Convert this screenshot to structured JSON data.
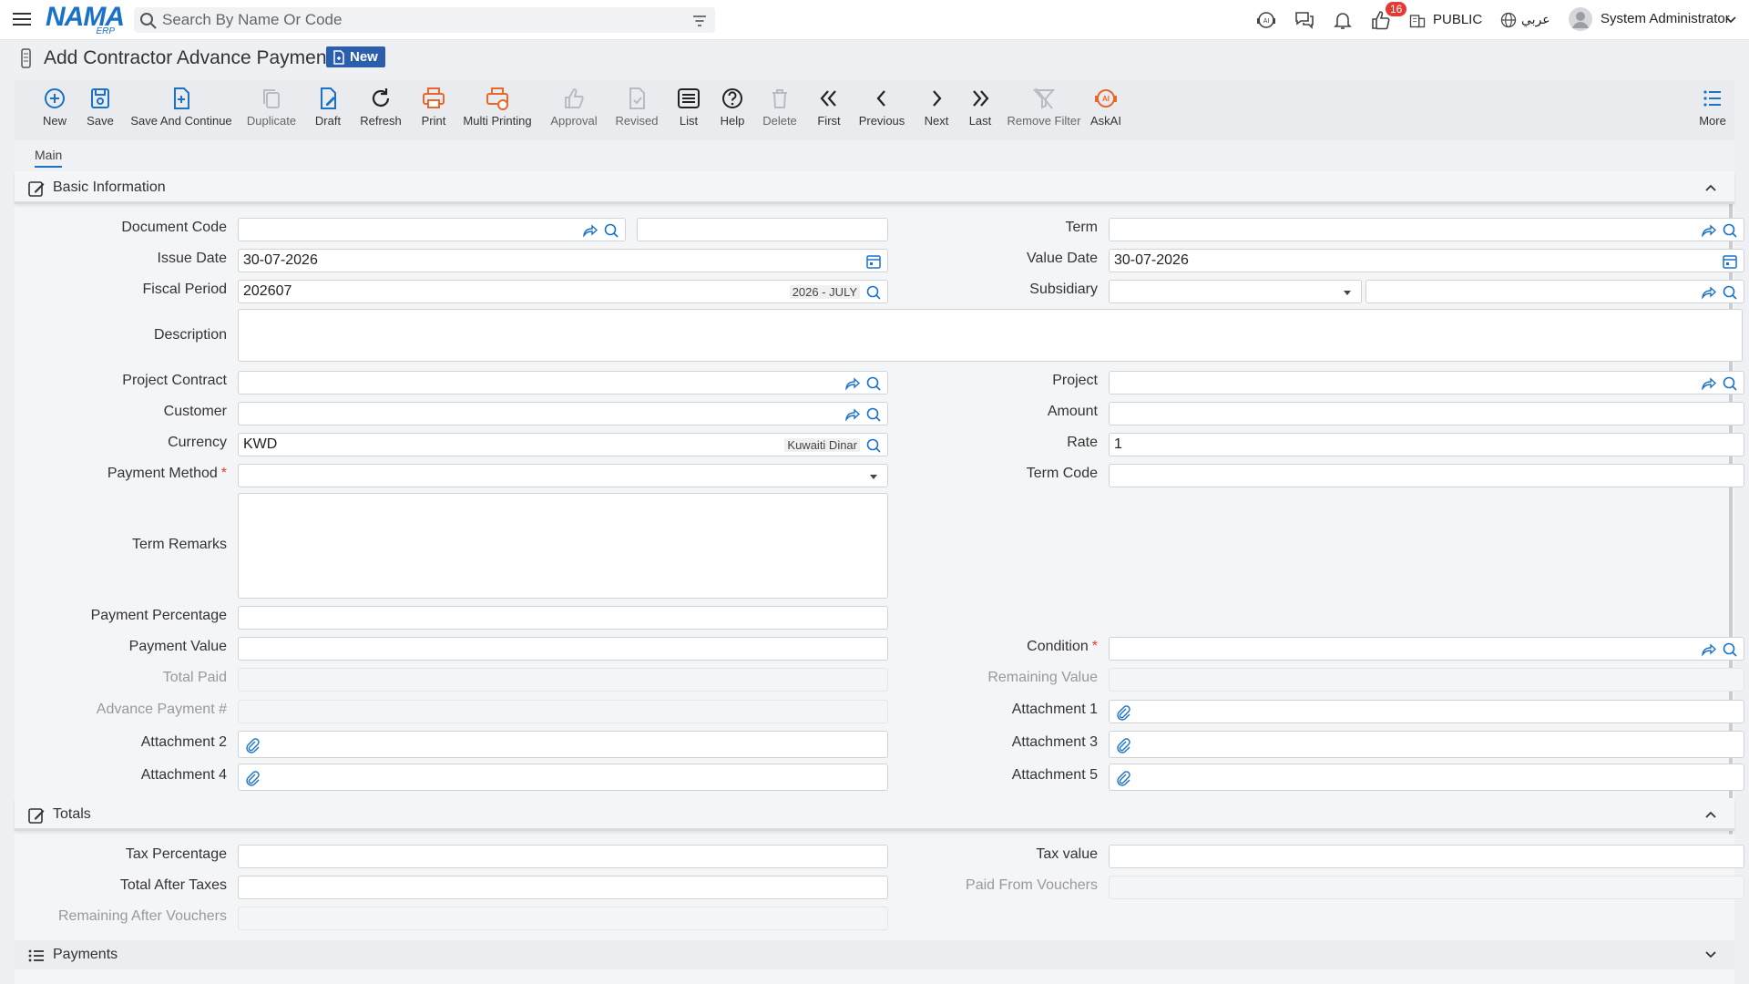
{
  "topbar": {
    "search_placeholder": "Search By Name Or Code",
    "logo": "NAMA",
    "logo_sub": "ERP",
    "notifications_count": "16",
    "public_label": "PUBLIC",
    "language_label": "عربي",
    "user_name": "System Administrator"
  },
  "page": {
    "title": "Add Contractor Advance Payment",
    "status_badge": "New"
  },
  "toolbar": {
    "new": "New",
    "save": "Save",
    "save_continue": "Save And Continue",
    "duplicate": "Duplicate",
    "draft": "Draft",
    "refresh": "Refresh",
    "print": "Print",
    "multi_printing": "Multi Printing",
    "approval": "Approval",
    "revised": "Revised",
    "list": "List",
    "help": "Help",
    "delete": "Delete",
    "first": "First",
    "previous": "Previous",
    "next": "Next",
    "last": "Last",
    "remove_filter": "Remove Filter",
    "askai": "AskAI",
    "more": "More"
  },
  "tabs": {
    "main": "Main"
  },
  "sections": {
    "basic": "Basic Information",
    "totals": "Totals",
    "payments": "Payments"
  },
  "labels": {
    "document_code": "Document Code",
    "term": "Term",
    "issue_date": "Issue Date",
    "value_date": "Value Date",
    "fiscal_period": "Fiscal Period",
    "subsidiary": "Subsidiary",
    "description": "Description",
    "project_contract": "Project Contract",
    "project": "Project",
    "customer": "Customer",
    "amount": "Amount",
    "currency": "Currency",
    "rate": "Rate",
    "payment_method": "Payment Method",
    "term_code": "Term Code",
    "term_remarks": "Term Remarks",
    "payment_percentage": "Payment Percentage",
    "payment_value": "Payment Value",
    "condition": "Condition",
    "total_paid": "Total Paid",
    "remaining_value": "Remaining Value",
    "advance_payment_no": "Advance Payment #",
    "attachment1": "Attachment 1",
    "attachment2": "Attachment 2",
    "attachment3": "Attachment 3",
    "attachment4": "Attachment 4",
    "attachment5": "Attachment 5",
    "tax_percentage": "Tax Percentage",
    "tax_value": "Tax value",
    "total_after_taxes": "Total After Taxes",
    "paid_from_vouchers": "Paid From Vouchers",
    "remaining_after_vouchers": "Remaining After Vouchers",
    "required_mark": "*"
  },
  "values": {
    "issue_date": "30-07-2026",
    "value_date": "30-07-2026",
    "fiscal_period": "202607",
    "fiscal_period_hint": "2026 - JULY",
    "currency": "KWD",
    "currency_hint": "Kuwaiti Dinar",
    "rate": "1"
  },
  "colors": {
    "accent": "#1a72c8",
    "badge": "#2b5fae",
    "print": "#e8672a",
    "required": "#e53935"
  }
}
